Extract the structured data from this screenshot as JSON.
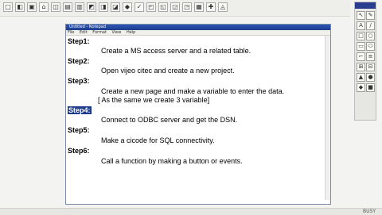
{
  "host": {
    "toolbar_buttons": [
      "□",
      "◧",
      "▣",
      "⌂",
      "◫",
      "▤",
      "▥",
      "◩",
      "◨",
      "◪",
      "◆",
      "✓",
      "◰",
      "◱",
      "◲",
      "◳",
      "▦",
      "✚",
      "◬"
    ],
    "status": "BUSY"
  },
  "palette": {
    "buttons": [
      "↖",
      "✎",
      "A",
      "/",
      "□",
      "○",
      "▭",
      "⬭",
      "⌐",
      "≡",
      "⊞",
      "⊟",
      "▲",
      "●",
      "◆",
      "■"
    ]
  },
  "notepad": {
    "title": "Untitled - Notepad",
    "menu": [
      "File",
      "Edit",
      "Format",
      "View",
      "Help"
    ],
    "lines": [
      {
        "kind": "step",
        "text": "Step1:"
      },
      {
        "kind": "text",
        "text": "Create a MS access server and a related table."
      },
      {
        "kind": "step",
        "text": "Step2:"
      },
      {
        "kind": "text",
        "text": "Open vijeo citec and create a new project."
      },
      {
        "kind": "step",
        "text": "Step3:"
      },
      {
        "kind": "text",
        "text": "Create a new page and make a variable to enter the data."
      },
      {
        "kind": "note",
        "text": "[ As the same we create 3 variable]"
      },
      {
        "kind": "step-hl",
        "text": "Step4:"
      },
      {
        "kind": "text-inline",
        "text": "Connect  to ODBC server and get the DSN."
      },
      {
        "kind": "step",
        "text": "Step5:"
      },
      {
        "kind": "text",
        "text": "Make a cicode for SQL connectivity."
      },
      {
        "kind": "step",
        "text": "Step6:"
      },
      {
        "kind": "text",
        "text": "Call a function by making a button or events."
      }
    ]
  }
}
